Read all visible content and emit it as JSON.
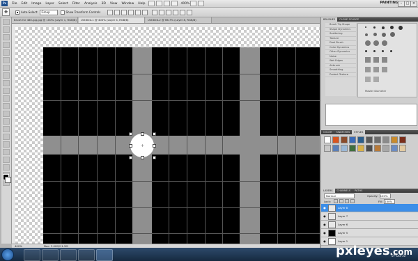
{
  "menubar": {
    "logo": "Ps",
    "items": [
      "File",
      "Edit",
      "Image",
      "Layer",
      "Select",
      "Filter",
      "Analysis",
      "3D",
      "View",
      "Window",
      "Help"
    ],
    "zoom": "400%",
    "workspace": "PAINTING"
  },
  "options": {
    "auto_select_label": "Auto-Select:",
    "auto_select_value": "Group",
    "transform_label": "Show Transform Controls"
  },
  "doc_tabs": [
    "Brush for 480-jpg.jpg @ 100% (Layer 1, RGB/8)",
    "Untitled-1 @ 400% (Layer 4, RGB/8)",
    "Untitled-2 @ 66.7% (Layer 8, RGB/8)"
  ],
  "status": {
    "zoom": "400%",
    "doc_size": "Doc: 3.00M/11.5M"
  },
  "brushes_panel": {
    "tabs": [
      "BRUSHES",
      "CLONE SOURCE"
    ],
    "presets": [
      "Brush Tip Shape",
      "Shape Dynamics",
      "Scattering",
      "Texture",
      "Dual Brush",
      "Color Dynamics",
      "Other Dynamics",
      "Noise",
      "Wet Edges",
      "Airbrush",
      "Smoothing",
      "Protect Texture"
    ],
    "master_diameter": "Master Diameter"
  },
  "styles_panel": {
    "tabs": [
      "COLOR",
      "SWATCHES",
      "STYLES"
    ]
  },
  "layers_panel": {
    "tabs": [
      "LAYERS",
      "CHANNELS",
      "PATHS"
    ],
    "blend_mode": "Normal",
    "opacity_label": "Opacity:",
    "opacity_value": "100%",
    "lock_label": "Lock:",
    "fill_label": "Fill:",
    "fill_value": "100%",
    "layers": [
      "Layer 8",
      "Layer 7",
      "Layer 6",
      "Layer 5",
      "Layer 1"
    ]
  },
  "taskbar": {
    "time": "07-Oct-10"
  },
  "watermark": {
    "text": "pxleyes",
    "suffix": ".com"
  }
}
